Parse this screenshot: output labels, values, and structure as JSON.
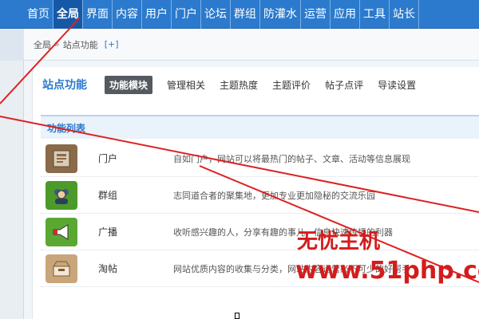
{
  "topnav": {
    "items": [
      "首页",
      "全局",
      "界面",
      "内容",
      "用户",
      "门户",
      "论坛",
      "群组",
      "防灌水",
      "运营",
      "应用",
      "工具",
      "站长"
    ],
    "active": "全局"
  },
  "breadcrumb": {
    "root": "全局",
    "separator": "»",
    "current": "站点功能",
    "add_label": "[+]"
  },
  "subnav": {
    "title": "站点功能",
    "tabs": [
      "功能模块",
      "管理相关",
      "主题热度",
      "主题评价",
      "帖子点评",
      "导读设置"
    ],
    "active": "功能模块"
  },
  "list": {
    "header": "功能列表",
    "rows": [
      {
        "name": "门户",
        "desc": "自如门户，网站可以将最热门的帖子、文章、活动等信息展现",
        "icon": "portal-icon",
        "color": "#8a6a48"
      },
      {
        "name": "群组",
        "desc": "志同道合者的聚集地，更加专业更加隐秘的交流乐园",
        "icon": "group-icon",
        "color": "#4c9a2a"
      },
      {
        "name": "广播",
        "desc": "收听感兴趣的人，分享有趣的事儿，信息快速传播的利器",
        "icon": "broadcast-icon",
        "color": "#5aa832"
      },
      {
        "name": "淘帖",
        "desc": "网站优质内容的收集与分类，网站内容运营必不可少的好帮手",
        "icon": "collection-icon",
        "color": "#c9a57c"
      }
    ]
  },
  "watermark": {
    "line1": "无忧主机",
    "line2": "www.51php.co"
  },
  "colors": {
    "nav_bg": "#2b7acd",
    "accent": "#2b7acd",
    "watermark": "#d41c1c"
  }
}
